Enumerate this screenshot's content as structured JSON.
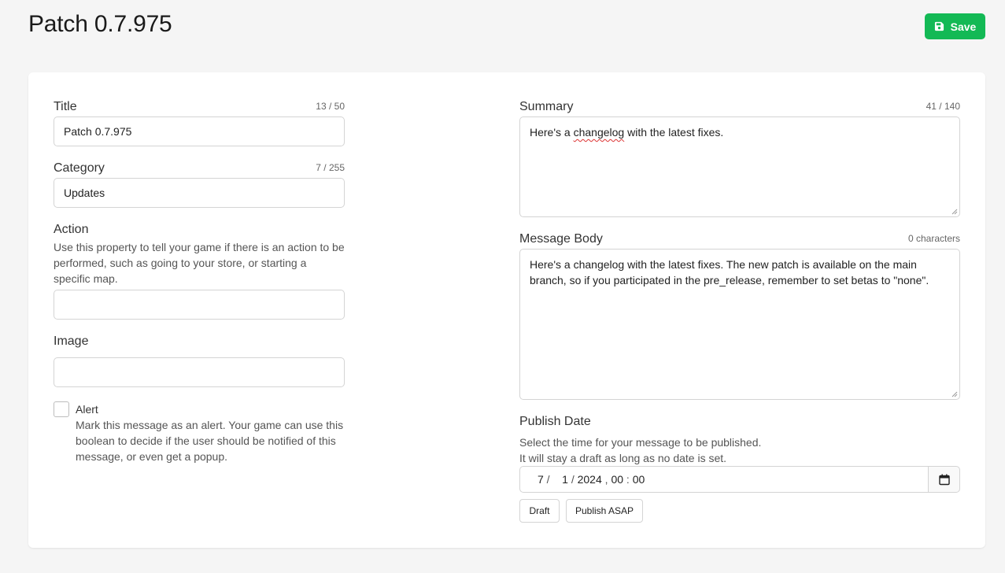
{
  "header": {
    "title": "Patch 0.7.975",
    "save_label": "Save"
  },
  "form": {
    "title": {
      "label": "Title",
      "counter": "13 / 50",
      "value": "Patch 0.7.975"
    },
    "category": {
      "label": "Category",
      "counter": "7 / 255",
      "value": "Updates"
    },
    "action": {
      "label": "Action",
      "help": "Use this property to tell your game if there is an action to be performed, such as going to your store, or starting a specific map.",
      "value": ""
    },
    "image": {
      "label": "Image",
      "value": ""
    },
    "alert": {
      "label": "Alert",
      "checked": false,
      "help": "Mark this message as an alert. Your game can use this boolean to decide if the user should be notified of this message, or even get a popup."
    },
    "summary": {
      "label": "Summary",
      "counter": "41 / 140",
      "value_before": "Here's a ",
      "value_misspelled": "changelog",
      "value_after": " with the latest fixes."
    },
    "message_body": {
      "label": "Message Body",
      "counter": "0 characters",
      "value": "Here's a changelog with the latest fixes. The new patch is available on the main branch, so if you participated in the pre_release, remember to set betas to \"none\"."
    },
    "publish_date": {
      "label": "Publish Date",
      "help_line1": "Select the time for your message to be published.",
      "help_line2": "It will stay a draft as long as no date is set.",
      "month": "7",
      "day": "1",
      "year": "2024",
      "hour": "00",
      "minute": "00",
      "draft_label": "Draft",
      "publish_asap_label": "Publish ASAP"
    }
  },
  "colors": {
    "accent": "#13b955",
    "background": "#f5f5f5",
    "card": "#ffffff"
  },
  "icons": {
    "save": "floppy-disk-icon",
    "calendar": "calendar-icon"
  }
}
